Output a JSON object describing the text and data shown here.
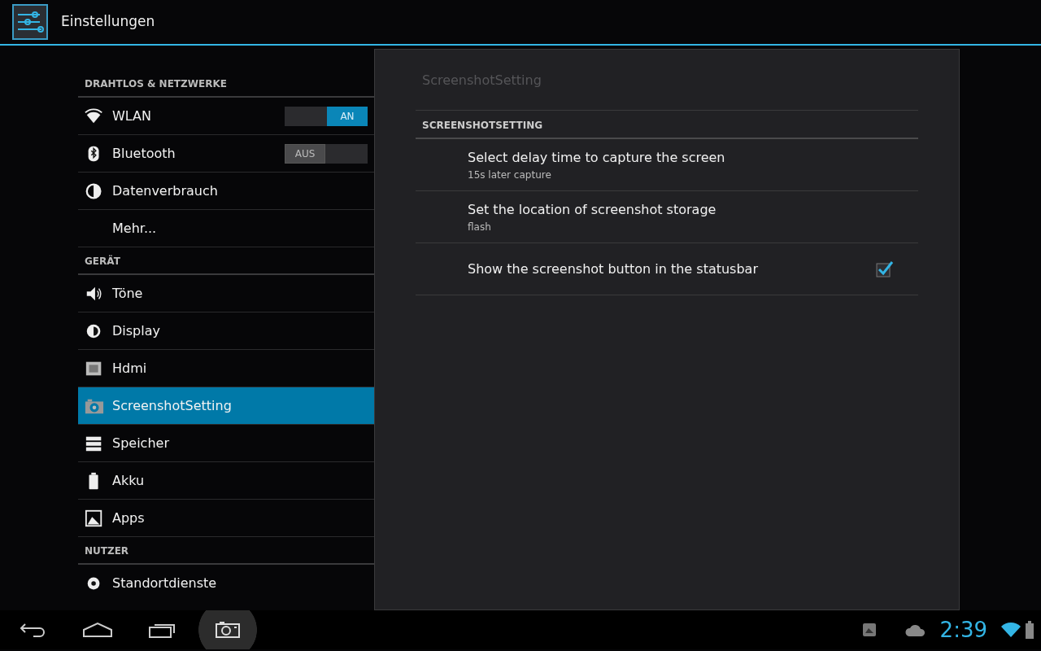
{
  "action_bar": {
    "title": "Einstellungen"
  },
  "sidebar": {
    "sections": [
      {
        "title": "DRAHTLOS & NETZWERKE",
        "items": [
          {
            "label": "WLAN",
            "selected": false,
            "toggle": {
              "label": "AN",
              "on": true
            }
          },
          {
            "label": "Bluetooth",
            "selected": false,
            "toggle": {
              "label": "AUS",
              "on": false
            }
          },
          {
            "label": "Datenverbrauch",
            "selected": false
          },
          {
            "label": "Mehr...",
            "selected": false
          }
        ]
      },
      {
        "title": "GERÄT",
        "items": [
          {
            "label": "Töne",
            "selected": false
          },
          {
            "label": "Display",
            "selected": false
          },
          {
            "label": "Hdmi",
            "selected": false
          },
          {
            "label": "ScreenshotSetting",
            "selected": true
          },
          {
            "label": "Speicher",
            "selected": false
          },
          {
            "label": "Akku",
            "selected": false
          },
          {
            "label": "Apps",
            "selected": false
          }
        ]
      },
      {
        "title": "NUTZER",
        "items": [
          {
            "label": "Standortdienste",
            "selected": false
          }
        ]
      }
    ]
  },
  "detail": {
    "title": "ScreenshotSetting",
    "category": "SCREENSHOTSETTING",
    "preferences": [
      {
        "kind": "text",
        "title": "Select delay time to capture the screen",
        "summary": "15s later capture"
      },
      {
        "kind": "text",
        "title": "Set the location of screenshot storage",
        "summary": "flash"
      },
      {
        "kind": "checkbox",
        "title": "Show the screenshot button in the statusbar",
        "checked": true
      }
    ]
  },
  "status_bar": {
    "time": "2:39"
  }
}
